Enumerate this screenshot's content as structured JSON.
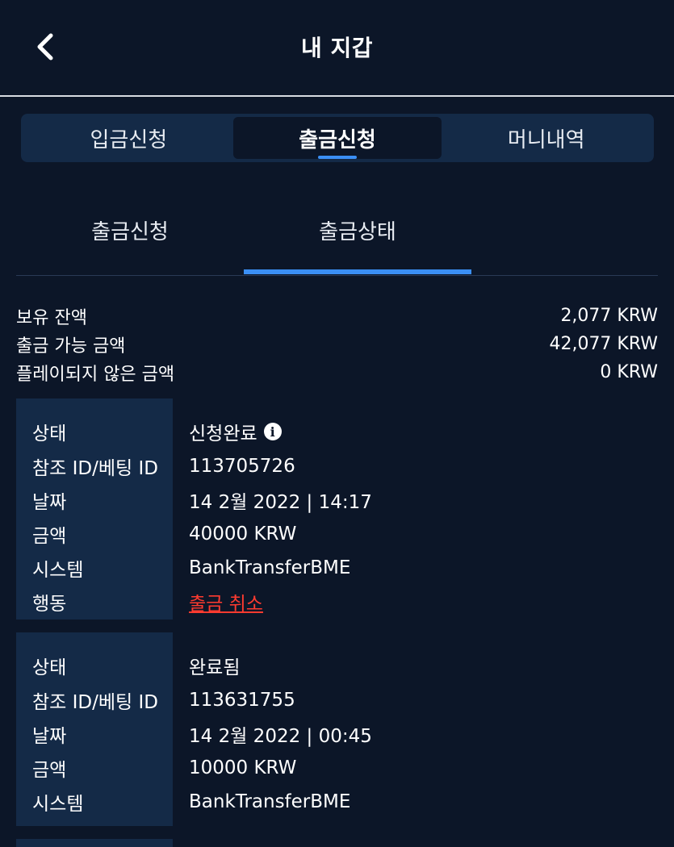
{
  "header": {
    "title": "내 지갑",
    "back_icon": "chevron-left-icon"
  },
  "main_tabs": [
    {
      "label": "입금신청",
      "active": false
    },
    {
      "label": "출금신청",
      "active": true
    },
    {
      "label": "머니내역",
      "active": false
    }
  ],
  "sub_tabs": [
    {
      "label": "출금신청",
      "active": false
    },
    {
      "label": "출금상태",
      "active": true
    }
  ],
  "balances": [
    {
      "label": "보유 잔액",
      "value": "2,077 KRW"
    },
    {
      "label": "출금 가능 금액",
      "value": "42,077 KRW"
    },
    {
      "label": "플레이되지 않은 금액",
      "value": "0 KRW"
    }
  ],
  "labels": {
    "status": "상태",
    "reference": "참조 ID/베팅 ID",
    "date": "날짜",
    "amount": "금액",
    "system": "시스템",
    "action": "행동"
  },
  "withdrawals": [
    {
      "status": "신청완료",
      "reference": "113705726",
      "date": "14 2월 2022 | 14:17",
      "amount": "40000 KRW",
      "system": "BankTransferBME",
      "action": "출금 취소"
    },
    {
      "status": "완료됨",
      "reference": "113631755",
      "date": "14 2월 2022 | 00:45",
      "amount": "10000 KRW",
      "system": "BankTransferBME"
    }
  ],
  "colors": {
    "background": "#0c1628",
    "panel": "#142a47",
    "accent": "#3b8ff5",
    "danger": "#ff3b30"
  }
}
